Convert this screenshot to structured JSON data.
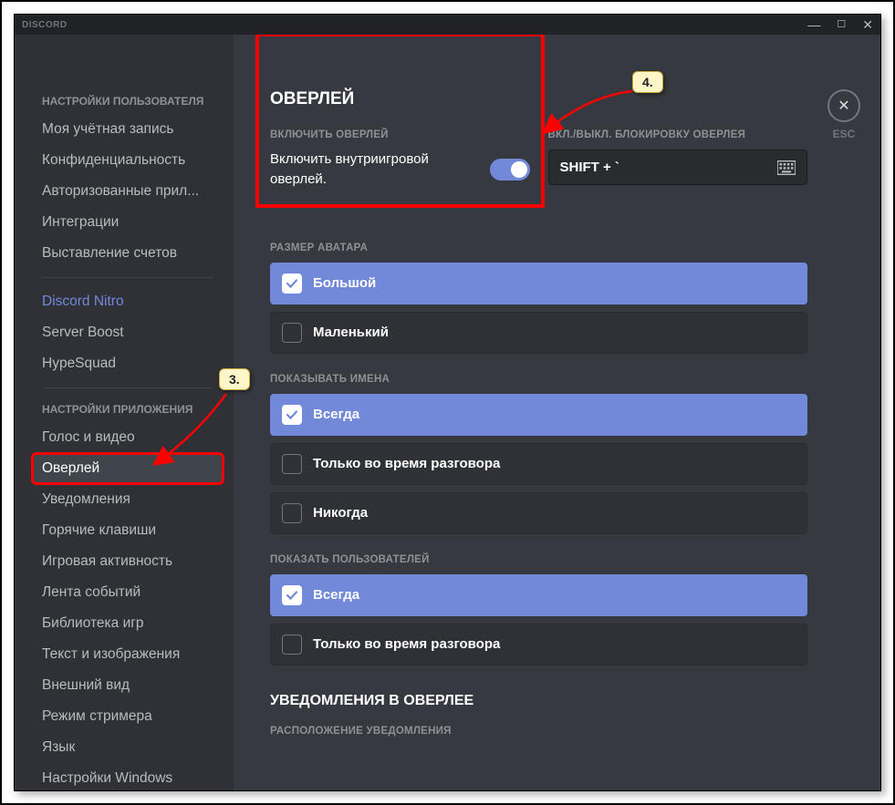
{
  "titlebar": {
    "brand": "DISCORD"
  },
  "esc": {
    "label": "ESC"
  },
  "sidebar": {
    "group1_header": "НАСТРОЙКИ ПОЛЬЗОВАТЕЛЯ",
    "group1": [
      "Моя учётная запись",
      "Конфиденциальность",
      "Авторизованные прил...",
      "Интеграции",
      "Выставление счетов"
    ],
    "group2": [
      "Discord Nitro",
      "Server Boost",
      "HypeSquad"
    ],
    "group3_header": "НАСТРОЙКИ ПРИЛОЖЕНИЯ",
    "group3": [
      "Голос и видео",
      "Оверлей",
      "Уведомления",
      "Горячие клавиши",
      "Игровая активность",
      "Лента событий",
      "Библиотека игр",
      "Текст и изображения",
      "Внешний вид",
      "Режим стримера",
      "Язык",
      "Настройки Windows"
    ]
  },
  "overlay": {
    "title": "ОВЕРЛЕЙ",
    "enable_label": "ВКЛЮЧИТЬ ОВЕРЛЕЙ",
    "enable_desc": "Включить внутриигровой оверлей.",
    "lock_label": "ВКЛ./ВЫКЛ. БЛОКИРОВКУ ОВЕРЛЕЯ",
    "lock_keybind": "SHIFT + `",
    "avatar_label": "РАЗМЕР АВАТАРА",
    "avatar_options": [
      "Большой",
      "Маленький"
    ],
    "names_label": "ПОКАЗЫВАТЬ ИМЕНА",
    "names_options": [
      "Всегда",
      "Только во время разговора",
      "Никогда"
    ],
    "users_label": "ПОКАЗАТЬ ПОЛЬЗОВАТЕЛЕЙ",
    "users_options": [
      "Всегда",
      "Только во время разговора"
    ],
    "notif_heading": "УВЕДОМЛЕНИЯ В ОВЕРЛЕЕ",
    "notif_pos_label": "РАСПОЛОЖЕНИЕ УВЕДОМЛЕНИЯ"
  },
  "annotations": {
    "a3": "3.",
    "a4": "4."
  }
}
